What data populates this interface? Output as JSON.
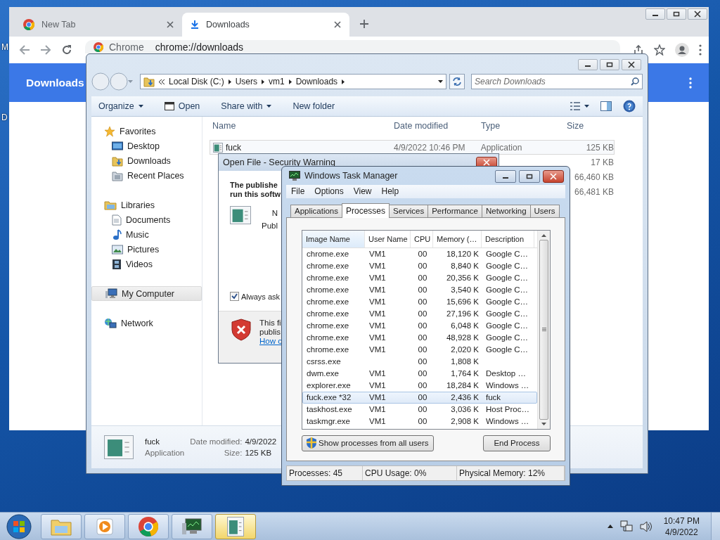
{
  "desktop": {
    "icon_labels": [
      "M",
      "D"
    ]
  },
  "browser": {
    "tabs": [
      {
        "label": "New Tab",
        "kind": "browser",
        "selected": false
      },
      {
        "label": "Downloads",
        "kind": "download",
        "selected": true
      }
    ],
    "omnibox": {
      "site": "Chrome",
      "url": "chrome://downloads"
    },
    "page_title": "Downloads"
  },
  "explorer": {
    "breadcrumb": [
      "Local Disk (C:)",
      "Users",
      "vm1",
      "Downloads"
    ],
    "search": {
      "placeholder": "Search Downloads"
    },
    "commands": [
      {
        "label": "Organize",
        "kind": "menu"
      },
      {
        "label": "Open",
        "kind": "icon"
      },
      {
        "label": "Share with",
        "kind": "menu"
      },
      {
        "label": "New folder",
        "kind": "plain"
      }
    ],
    "nav": [
      {
        "label": "Favorites",
        "kind": "star",
        "selected": false,
        "children": [
          {
            "label": "Desktop",
            "kind": "desktop",
            "selected": false
          },
          {
            "label": "Downloads",
            "kind": "downloads",
            "selected": false
          },
          {
            "label": "Recent Places",
            "kind": "recent",
            "selected": false
          }
        ]
      },
      {
        "label": "Libraries",
        "kind": "libraries",
        "selected": false,
        "children": [
          {
            "label": "Documents",
            "kind": "documents",
            "selected": false
          },
          {
            "label": "Music",
            "kind": "music",
            "selected": false
          },
          {
            "label": "Pictures",
            "kind": "pictures",
            "selected": false
          },
          {
            "label": "Videos",
            "kind": "videos",
            "selected": false
          }
        ]
      },
      {
        "label": "My Computer",
        "kind": "computer",
        "selected": true
      },
      {
        "label": "Network",
        "kind": "network",
        "selected": false
      }
    ],
    "columns": [
      "Name",
      "Date modified",
      "Type",
      "Size"
    ],
    "files": [
      {
        "name": "fuck",
        "date": "4/9/2022 10:46 PM",
        "type": "Application",
        "size": "125 KB",
        "selected": true
      },
      {
        "size": "17 KB",
        "selected": false
      },
      {
        "size": "66,460 KB",
        "selected": false
      },
      {
        "size": "66,481 KB",
        "selected": false
      }
    ],
    "details": {
      "name": "fuck",
      "type": "Application",
      "date_label": "Date modified:",
      "date": "4/9/2022",
      "size_label": "Size:",
      "size": "125 KB"
    }
  },
  "security_warning": {
    "title": "Open File - Security Warning",
    "heading": [
      "The publishe",
      "run this softw"
    ],
    "fields": [
      "N",
      "Publ"
    ],
    "always_ask": {
      "label": "Always ask",
      "checked": true
    },
    "warning": [
      "This fi",
      "publis"
    ],
    "link": "How c"
  },
  "task_manager": {
    "title": "Windows Task Manager",
    "menu": [
      "File",
      "Options",
      "View",
      "Help"
    ],
    "tabs": [
      {
        "label": "Applications",
        "selected": false
      },
      {
        "label": "Processes",
        "selected": true
      },
      {
        "label": "Services",
        "selected": false
      },
      {
        "label": "Performance",
        "selected": false
      },
      {
        "label": "Networking",
        "selected": false
      },
      {
        "label": "Users",
        "selected": false
      }
    ],
    "columns": [
      "Image Name",
      "User Name",
      "CPU",
      "Memory (…",
      "Description"
    ],
    "processes": [
      {
        "image": "chrome.exe",
        "user": "VM1",
        "cpu": "00",
        "memory": "18,120 K",
        "description": "Google C…",
        "selected": false
      },
      {
        "image": "chrome.exe",
        "user": "VM1",
        "cpu": "00",
        "memory": "8,840 K",
        "description": "Google C…",
        "selected": false
      },
      {
        "image": "chrome.exe",
        "user": "VM1",
        "cpu": "00",
        "memory": "20,356 K",
        "description": "Google C…",
        "selected": false
      },
      {
        "image": "chrome.exe",
        "user": "VM1",
        "cpu": "00",
        "memory": "3,540 K",
        "description": "Google C…",
        "selected": false
      },
      {
        "image": "chrome.exe",
        "user": "VM1",
        "cpu": "00",
        "memory": "15,696 K",
        "description": "Google C…",
        "selected": false
      },
      {
        "image": "chrome.exe",
        "user": "VM1",
        "cpu": "00",
        "memory": "27,196 K",
        "description": "Google C…",
        "selected": false
      },
      {
        "image": "chrome.exe",
        "user": "VM1",
        "cpu": "00",
        "memory": "6,048 K",
        "description": "Google C…",
        "selected": false
      },
      {
        "image": "chrome.exe",
        "user": "VM1",
        "cpu": "00",
        "memory": "48,928 K",
        "description": "Google C…",
        "selected": false
      },
      {
        "image": "chrome.exe",
        "user": "VM1",
        "cpu": "00",
        "memory": "2,020 K",
        "description": "Google C…",
        "selected": false
      },
      {
        "image": "csrss.exe",
        "cpu": "00",
        "memory": "1,808 K",
        "selected": false
      },
      {
        "image": "dwm.exe",
        "user": "VM1",
        "cpu": "00",
        "memory": "1,764 K",
        "description": "Desktop …",
        "selected": false
      },
      {
        "image": "explorer.exe",
        "user": "VM1",
        "cpu": "00",
        "memory": "18,284 K",
        "description": "Windows …",
        "selected": false
      },
      {
        "image": "fuck.exe *32",
        "user": "VM1",
        "cpu": "00",
        "memory": "2,436 K",
        "description": "fuck",
        "selected": true
      },
      {
        "image": "taskhost.exe",
        "user": "VM1",
        "cpu": "00",
        "memory": "3,036 K",
        "description": "Host Proc…",
        "selected": false
      },
      {
        "image": "taskmgr.exe",
        "user": "VM1",
        "cpu": "00",
        "memory": "2,908 K",
        "description": "Windows …",
        "selected": false
      }
    ],
    "buttons": {
      "show_all": "Show processes from all users",
      "end": "End Process"
    },
    "status": [
      "Processes: 45",
      "CPU Usage: 0%",
      "Physical Memory: 12%"
    ]
  },
  "taskbar": {
    "apps": [
      {
        "kind": "folder",
        "selected": false
      },
      {
        "kind": "player",
        "selected": false
      },
      {
        "kind": "browser",
        "selected": false
      },
      {
        "kind": "monitor",
        "selected": false
      },
      {
        "kind": "app",
        "selected": true
      }
    ],
    "time": "10:47 PM",
    "date": "4/9/2022"
  }
}
